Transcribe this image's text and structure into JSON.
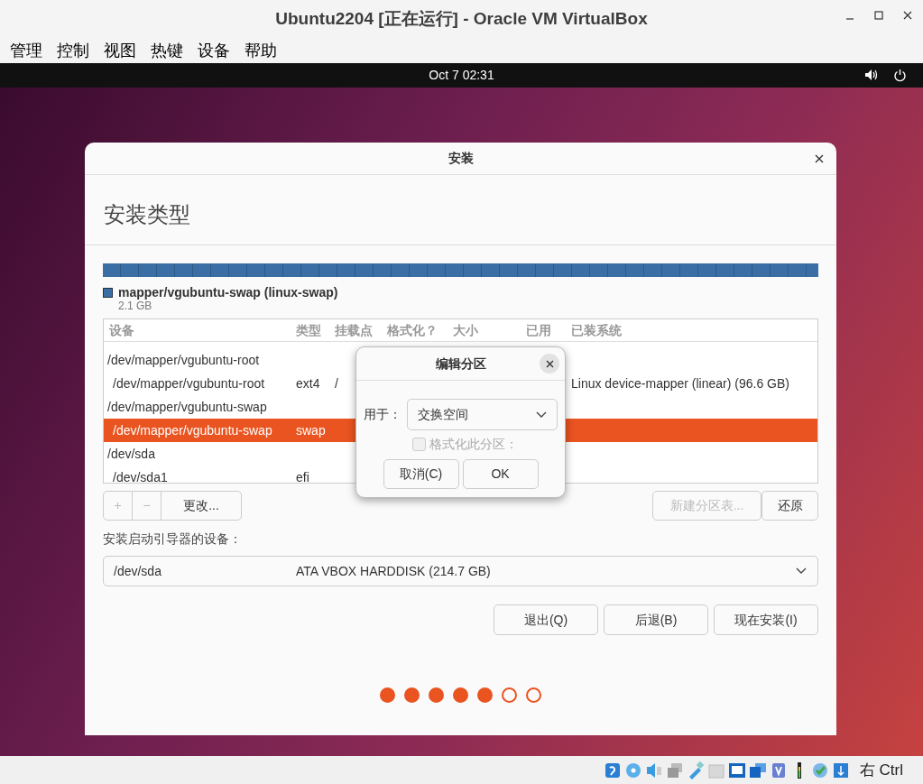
{
  "window": {
    "title": "Ubuntu2204 [正在运行] - Oracle VM VirtualBox"
  },
  "menu": [
    "管理",
    "控制",
    "视图",
    "热键",
    "设备",
    "帮助"
  ],
  "top_bar": {
    "clock": "Oct 7  02:31"
  },
  "installer": {
    "title": "安装",
    "heading": "安装类型",
    "partition_bar": {
      "label": "mapper/vgubuntu-swap (linux-swap)",
      "size": "2.1 GB",
      "color": "#3a6ea5"
    },
    "columns": [
      "设备",
      "类型",
      "挂载点",
      "格式化？",
      "大小",
      "已用",
      "已装系统"
    ],
    "disks": [
      {
        "device": "/dev/mapper/vgubuntu-root",
        "children": [
          {
            "device": "/dev/mapper/vgubuntu-root",
            "type": "ext4",
            "mount": "/",
            "system": "Linux device-mapper (linear) (96.6 GB)",
            "selected": false
          }
        ]
      },
      {
        "device": "/dev/mapper/vgubuntu-swap",
        "children": [
          {
            "device": "/dev/mapper/vgubuntu-swap",
            "type": "swap",
            "selected": true
          }
        ]
      },
      {
        "device": "/dev/sda",
        "children": [
          {
            "device": "/dev/sda1",
            "type": "efi",
            "selected": false
          }
        ]
      }
    ],
    "table_buttons": [
      {
        "label": "+",
        "disabled": true
      },
      {
        "label": "−",
        "disabled": true
      },
      {
        "label": "更改...",
        "disabled": false
      }
    ],
    "right_buttons": [
      {
        "label": "新建分区表...",
        "disabled": true
      },
      {
        "label": "还原",
        "disabled": false
      }
    ],
    "boot_label": "安装启动引导器的设备：",
    "boot_device": {
      "device": "/dev/sda",
      "description": "ATA VBOX HARDDISK (214.7 GB)"
    },
    "actions": [
      "退出(Q)",
      "后退(B)",
      "现在安装(I)"
    ],
    "steps": [
      {
        "completed": true
      },
      {
        "completed": true
      },
      {
        "completed": true
      },
      {
        "completed": true
      },
      {
        "completed": true
      },
      {
        "completed": false
      },
      {
        "completed": false
      }
    ]
  },
  "dialog": {
    "title": "编辑分区",
    "use_label": "用于：",
    "use_value": "交换空间",
    "format_label": "格式化此分区：",
    "format_checked": false,
    "format_disabled": true,
    "buttons": [
      "取消(C)",
      "OK"
    ]
  },
  "status_bar": {
    "host_key": "右 Ctrl"
  }
}
